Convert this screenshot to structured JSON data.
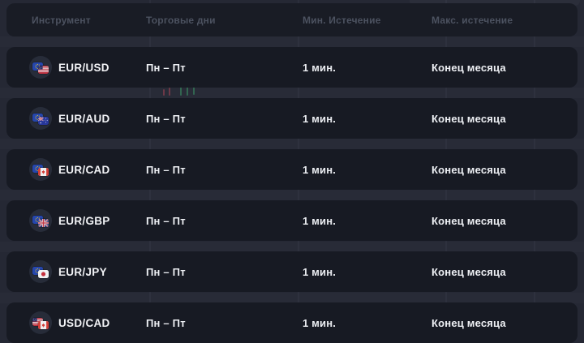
{
  "header": {
    "columns": [
      {
        "label": "Инструмент"
      },
      {
        "label": "Торговые дни"
      },
      {
        "label": "Мин. Истечение"
      },
      {
        "label": "Макс. истечение"
      }
    ]
  },
  "table": {
    "rows": [
      {
        "pair": "EUR/USD",
        "icons": [
          "eu-flag-icon",
          "us-flag-icon"
        ],
        "trading_days": "Пн – Пт",
        "min_expiration": "1 мин.",
        "max_expiration": "Конец месяца"
      },
      {
        "pair": "EUR/AUD",
        "icons": [
          "eu-flag-icon",
          "au-flag-icon"
        ],
        "trading_days": "Пн – Пт",
        "min_expiration": "1 мин.",
        "max_expiration": "Конец месяца"
      },
      {
        "pair": "EUR/CAD",
        "icons": [
          "eu-flag-icon",
          "ca-flag-icon"
        ],
        "trading_days": "Пн – Пт",
        "min_expiration": "1 мин.",
        "max_expiration": "Конец месяца"
      },
      {
        "pair": "EUR/GBP",
        "icons": [
          "eu-flag-icon",
          "gb-flag-icon"
        ],
        "trading_days": "Пн – Пт",
        "min_expiration": "1 мин.",
        "max_expiration": "Конец месяца"
      },
      {
        "pair": "EUR/JPY",
        "icons": [
          "eu-flag-icon",
          "jp-flag-icon"
        ],
        "trading_days": "Пн – Пт",
        "min_expiration": "1 мин.",
        "max_expiration": "Конец месяца"
      },
      {
        "pair": "USD/CAD",
        "icons": [
          "us-flag-icon",
          "ca-flag-icon"
        ],
        "trading_days": "Пн – Пт",
        "min_expiration": "1 мин.",
        "max_expiration": "Конец месяца"
      }
    ]
  },
  "colors": {
    "page_background": "#252834",
    "panel_background": "#171a23",
    "header_text": "#4c5260",
    "row_text": "#eef0f4"
  }
}
